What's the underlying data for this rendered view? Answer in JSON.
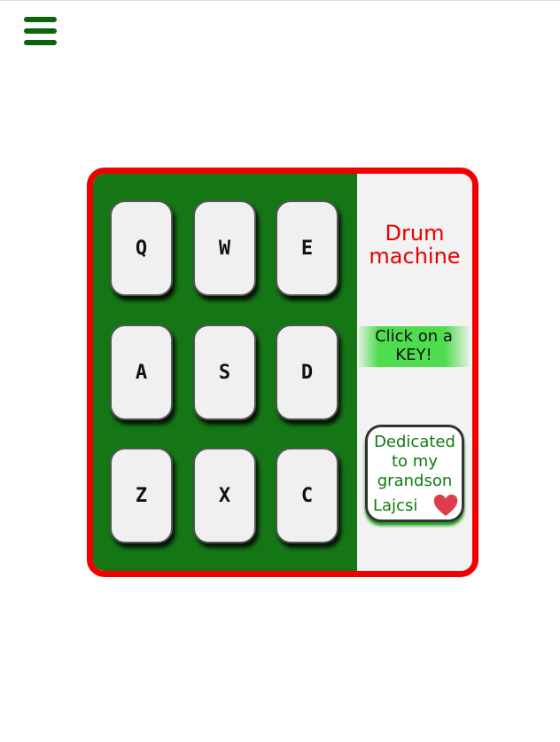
{
  "menu": {
    "icon": "hamburger-menu-icon",
    "color": "#0b640b"
  },
  "drum_machine": {
    "border_color": "#f20000",
    "pad_area_color": "#157615",
    "pads": [
      {
        "key": "Q"
      },
      {
        "key": "W"
      },
      {
        "key": "E"
      },
      {
        "key": "A"
      },
      {
        "key": "S"
      },
      {
        "key": "D"
      },
      {
        "key": "Z"
      },
      {
        "key": "X"
      },
      {
        "key": "C"
      }
    ]
  },
  "side_panel": {
    "title_line1": "Drum",
    "title_line2": "machine",
    "title_color": "#e60000",
    "display_line1": "Click on a",
    "display_line2": "KEY!",
    "dedication_line1": "Dedicated",
    "dedication_line2": "to my",
    "dedication_line3": "grandson",
    "dedication_name": "Lajcsi",
    "dedication_icon": "heart-icon",
    "dedication_color": "#0f7a0f",
    "heart_color": "#de3d4d"
  }
}
